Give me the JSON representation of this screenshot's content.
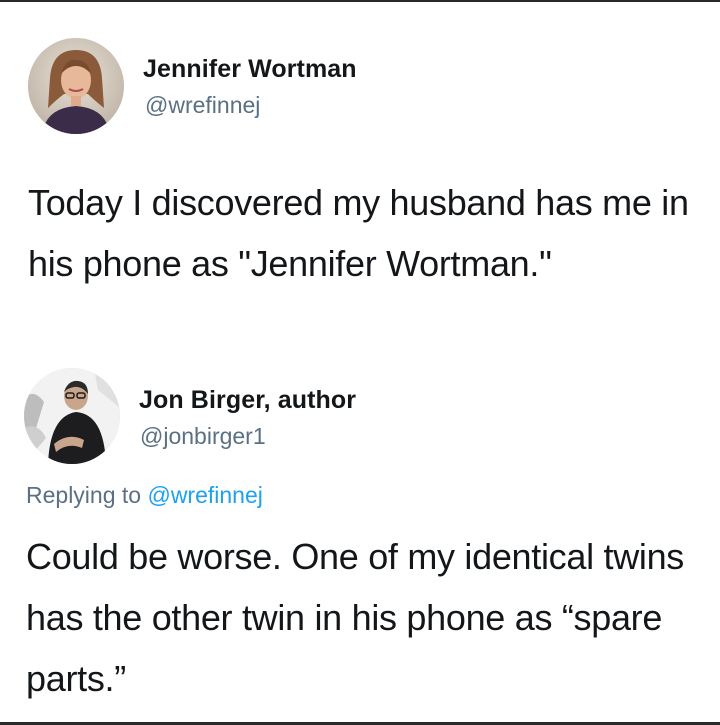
{
  "tweets": [
    {
      "author_name": "Jennifer Wortman",
      "author_handle": "@wrefinnej",
      "avatar": "woman-portrait-avatar",
      "text": "Today I discovered my husband has me in his phone as \"Jennifer Wortman.\""
    },
    {
      "author_name": "Jon Birger, author",
      "author_handle": "@jonbirger1",
      "avatar": "man-portrait-avatar",
      "replying_prefix": "Replying to ",
      "replying_to": "@wrefinnej",
      "text": "Could be worse. One of my identical twins has the other twin in his phone as “spare parts.”"
    }
  ],
  "colors": {
    "text": "#14171a",
    "secondary": "#5b7083",
    "mention": "#1da1f2"
  }
}
